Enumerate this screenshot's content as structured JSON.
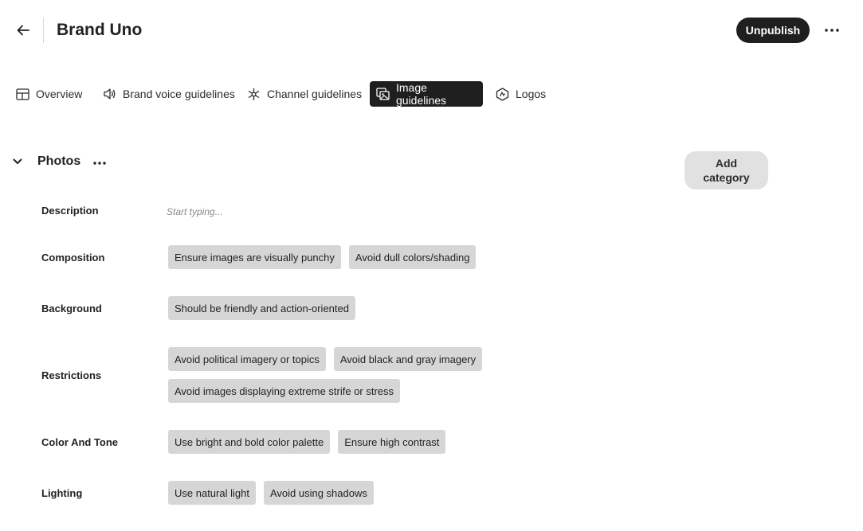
{
  "header": {
    "title": "Brand Uno",
    "unpublish_label": "Unpublish",
    "back_icon": "arrow-left-icon",
    "more_icon": "more-horizontal-icon"
  },
  "tabs": [
    {
      "label": "Overview",
      "icon": "layout-icon",
      "active": false
    },
    {
      "label": "Brand voice guidelines",
      "icon": "speaker-icon",
      "active": false
    },
    {
      "label": "Channel guidelines",
      "icon": "network-icon",
      "active": false
    },
    {
      "label": "Image guidelines",
      "icon": "images-icon",
      "active": true
    },
    {
      "label": "Logos",
      "icon": "logo-badge-icon",
      "active": false
    }
  ],
  "section": {
    "title": "Photos",
    "add_category_line1": "Add",
    "add_category_line2": "category",
    "description_label": "Description",
    "description_placeholder": "Start typing...",
    "rows": [
      {
        "label": "Composition",
        "chips": [
          "Ensure images are visually punchy",
          "Avoid dull colors/shading"
        ]
      },
      {
        "label": "Background",
        "chips": [
          "Should be friendly and action-oriented"
        ]
      },
      {
        "label": "Restrictions",
        "chips": [
          "Avoid political imagery or topics",
          "Avoid black and gray imagery",
          "Avoid images displaying extreme strife or stress"
        ]
      },
      {
        "label": "Color And Tone",
        "chips": [
          "Use bright and bold color palette",
          "Ensure high contrast"
        ]
      },
      {
        "label": "Lighting",
        "chips": [
          "Use natural light",
          "Avoid using shadows"
        ]
      }
    ]
  },
  "colors": {
    "primary_button": "#1f1f1f",
    "chip_bg": "#d6d6d6",
    "secondary_button": "#e1e1e1"
  }
}
